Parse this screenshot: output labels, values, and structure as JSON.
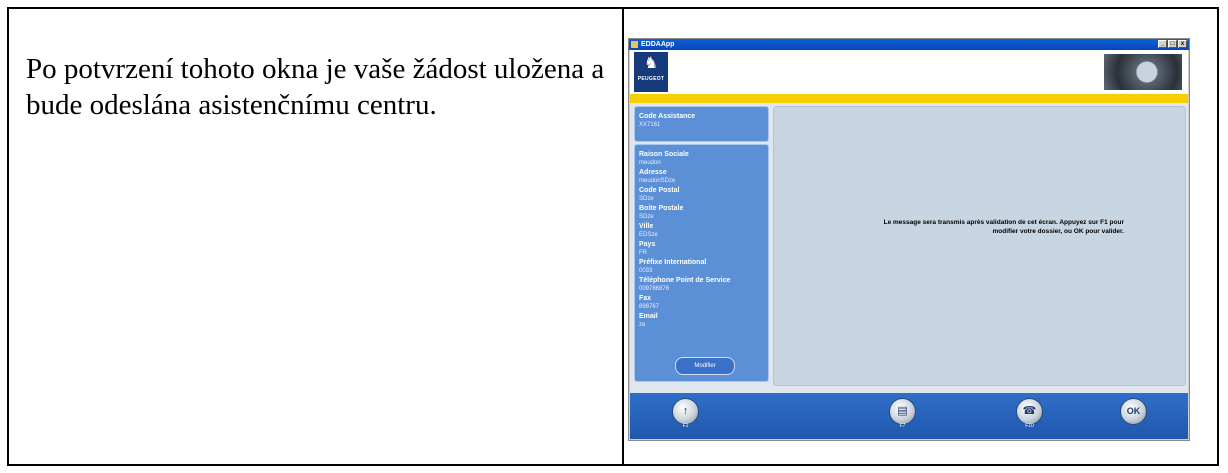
{
  "document": {
    "text": "Po potvrzení tohoto okna je vaše žádost uložena a bude odeslána asistenčnímu centru."
  },
  "app": {
    "window_title": "EDDAApp",
    "window_buttons": [
      "_",
      "□",
      "x"
    ],
    "brand": "PEUGEOT",
    "code_panel": {
      "label": "Code Assistance",
      "value": "XX7161"
    },
    "fields": [
      {
        "label": "Raison Sociale",
        "value": "meudon"
      },
      {
        "label": "Adresse",
        "value": "meudonSDze"
      },
      {
        "label": "Code Postal",
        "value": "SDze"
      },
      {
        "label": "Boite Postale",
        "value": "SDze"
      },
      {
        "label": "Ville",
        "value": "EDSze"
      },
      {
        "label": "Pays",
        "value": "FR"
      },
      {
        "label": "Préfixe International",
        "value": "0033"
      },
      {
        "label": "Téléphone Point de Service",
        "value": "009786876"
      },
      {
        "label": "Fax",
        "value": "898767"
      },
      {
        "label": "Email",
        "value": "ze"
      }
    ],
    "modify_label": "Modifier",
    "message_line1": "Le message sera transmis après validation de cet écran. Appuyez sur F1 pour",
    "message_line2": "modifier votre dossier, ou OK pour valider.",
    "footer_buttons": [
      {
        "name": "f1",
        "icon": "up-arrow-icon",
        "key": "F1"
      },
      {
        "name": "f7",
        "icon": "document-icon",
        "key": "F7"
      },
      {
        "name": "f10",
        "icon": "phone-icon",
        "key": "F10"
      },
      {
        "name": "ok",
        "icon": "ok-icon",
        "label": "OK"
      }
    ]
  }
}
